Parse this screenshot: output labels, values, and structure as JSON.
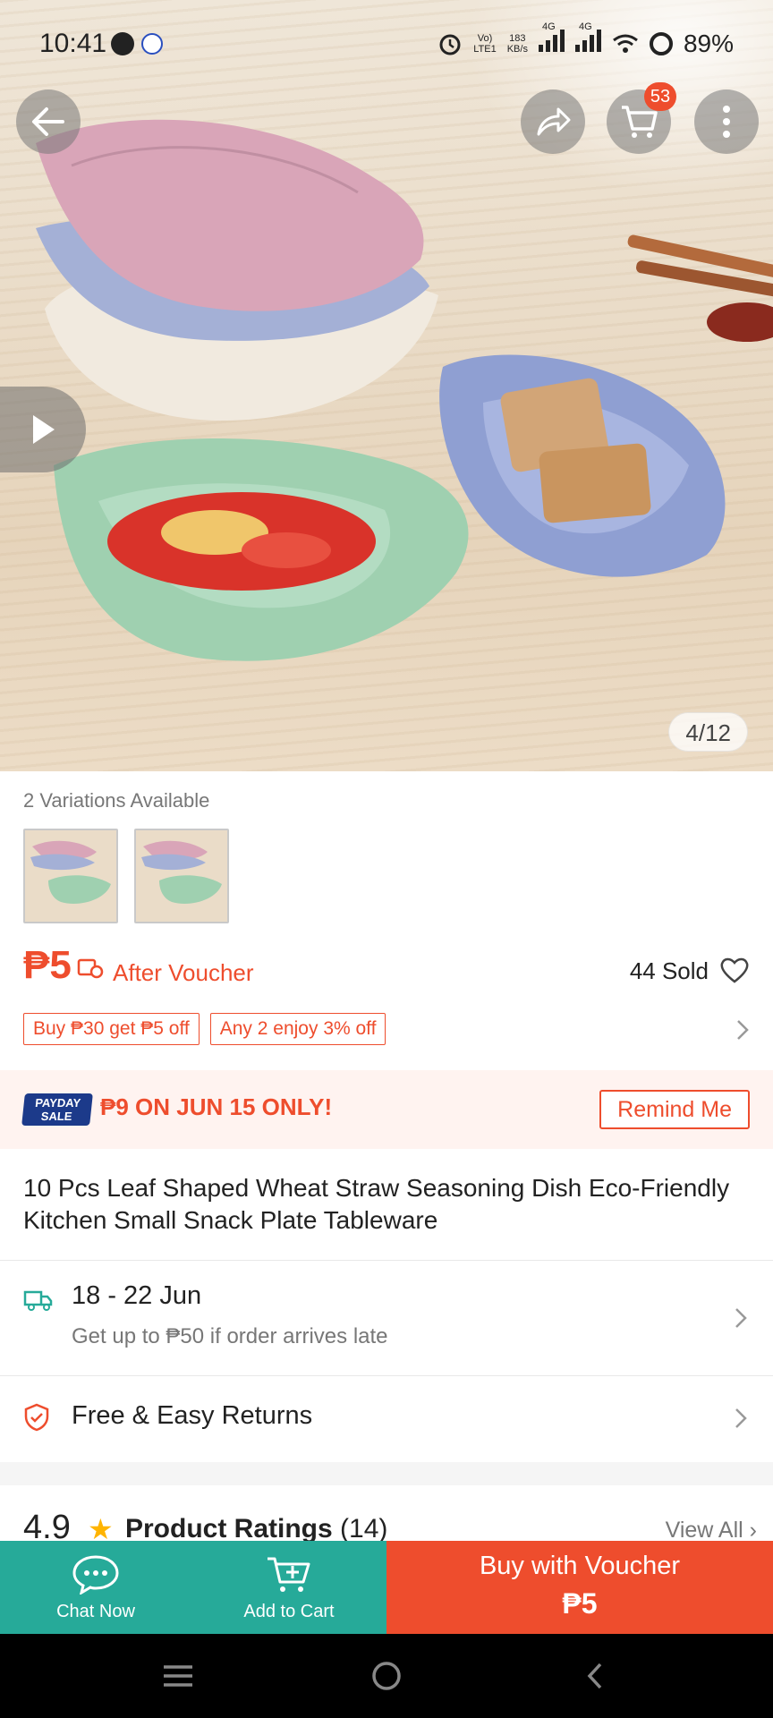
{
  "status_bar": {
    "time": "10:41",
    "net_speed_value": "183",
    "net_speed_unit": "KB/s",
    "volte_label": "Vo)",
    "lte_label": "LTE1",
    "network_1": "4G",
    "network_2": "4G",
    "battery": "89%"
  },
  "header": {
    "cart_count": "53"
  },
  "gallery": {
    "counter": "4/12"
  },
  "variations": {
    "label": "2 Variations Available"
  },
  "pricing": {
    "price": "₱5",
    "after_voucher": "After Voucher",
    "sold": "44 Sold"
  },
  "promos": {
    "tags": [
      "Buy ₱30 get ₱5 off",
      "Any 2 enjoy 3% off"
    ]
  },
  "payday": {
    "logo_line1": "PAYDAY",
    "logo_line2": "SALE",
    "text": "₱9 ON JUN 15 ONLY!",
    "remind_label": "Remind Me"
  },
  "product": {
    "title": "10 Pcs Leaf Shaped Wheat Straw Seasoning Dish Eco-Friendly Kitchen Small Snack Plate Tableware"
  },
  "delivery": {
    "date_range": "18 - 22 Jun",
    "note": "Get up to ₱50 if order arrives late"
  },
  "returns": {
    "label": "Free & Easy Returns"
  },
  "ratings": {
    "score": "4.9",
    "label": "Product Ratings",
    "count": "(14)",
    "view_all": "View All"
  },
  "action_bar": {
    "chat_label": "Chat Now",
    "add_cart_label": "Add to Cart",
    "buy_line1": "Buy with Voucher",
    "buy_line2": "₱5"
  },
  "colors": {
    "brand_orange": "#ee4d2d",
    "teal": "#26aa99",
    "star": "#ffb400"
  },
  "icons": [
    "back-arrow-icon",
    "share-icon",
    "cart-icon",
    "more-vertical-icon",
    "play-icon",
    "voucher-icon",
    "heart-icon",
    "chevron-right-icon",
    "truck-icon",
    "shield-check-icon",
    "star-icon",
    "chat-bubble-icon",
    "cart-plus-icon",
    "nav-menu-icon",
    "nav-home-icon",
    "nav-back-icon"
  ]
}
